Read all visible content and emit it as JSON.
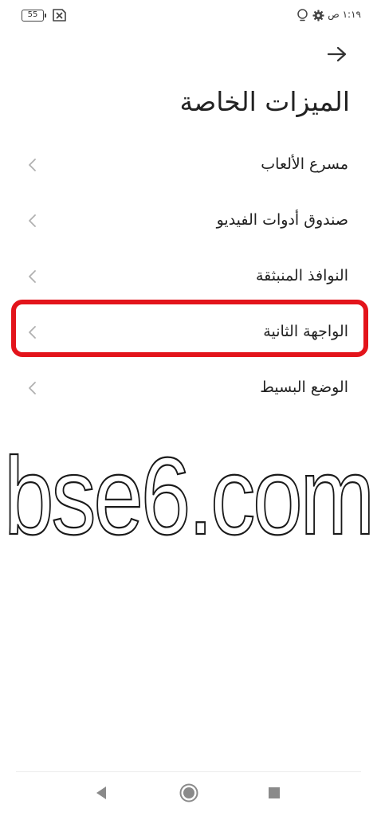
{
  "status_bar": {
    "battery_level": "55",
    "time": "١:١٩ ص",
    "icons": [
      "battery-icon",
      "sim-off-icon",
      "gear-icon",
      "bulb-icon"
    ]
  },
  "header": {
    "back_icon": "arrow-right-icon",
    "title": "الميزات الخاصة"
  },
  "menu": {
    "items": [
      {
        "label": "مسرع الألعاب"
      },
      {
        "label": "صندوق أدوات الفيديو"
      },
      {
        "label": "النوافذ المنبثقة"
      },
      {
        "label": "الواجهة الثانية",
        "highlighted": true
      },
      {
        "label": "الوضع البسيط"
      }
    ]
  },
  "highlight_color": "#e3141b",
  "watermark": "bse6.com",
  "nav_bar": {
    "icons": [
      "nav-back-icon",
      "nav-home-icon",
      "nav-recents-icon"
    ]
  }
}
